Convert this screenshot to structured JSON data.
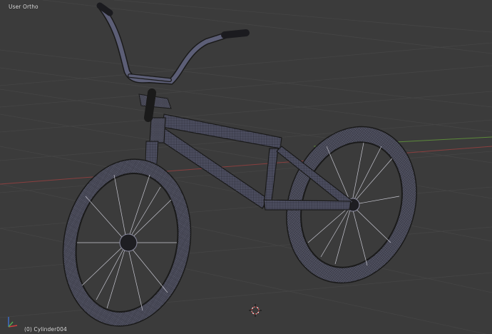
{
  "viewport": {
    "view_label": "User Ortho",
    "object_label": "(0) Cylinder004"
  },
  "colors": {
    "background": "#3b3b3b",
    "grid": "#444444",
    "axis_x": "#8a3f3f",
    "axis_y": "#5c8a3a",
    "wire": "#1a1a1a",
    "tire_fill": "#7a7c92",
    "frame_fill": "#6e7090",
    "spoke": "#c8c8d2"
  },
  "icons": {
    "axis_gizmo": "axis-gizmo-icon",
    "cursor_3d": "3d-cursor-icon"
  }
}
